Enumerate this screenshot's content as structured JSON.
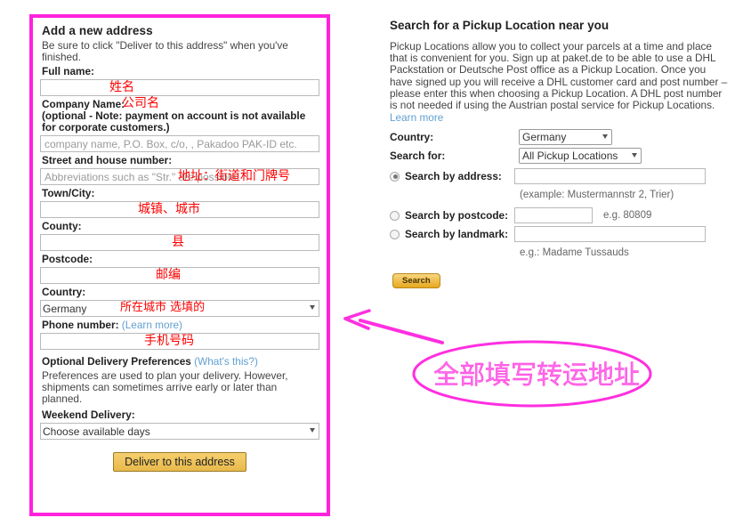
{
  "left_form": {
    "title": "Add a new address",
    "subtitle": "Be sure to click \"Deliver to this address\" when you've finished.",
    "fields": {
      "full_name_label": "Full name:",
      "full_name_value": "",
      "full_name_annotation": "姓名",
      "company_label": "Company Name:",
      "company_annotation": "公司名",
      "company_note": "(optional - Note: payment on account is not available for corporate customers.)",
      "company_placeholder": "company name, P.O. Box, c/o, , Pakadoo PAK-ID etc.",
      "street_label": "Street and house number:",
      "street_placeholder": "Abbreviations such as \"Str.\" are possible.",
      "street_annotation": "地址：街道和门牌号",
      "town_label": "Town/City:",
      "town_annotation": "城镇、城市",
      "county_label": "County:",
      "county_annotation": "县",
      "postcode_label": "Postcode:",
      "postcode_annotation": "邮编",
      "country_label": "Country:",
      "country_value": "Germany",
      "country_annotation": "所在城市 选填的",
      "phone_label": "Phone number:",
      "phone_learn_more": "(Learn more)",
      "phone_annotation": "手机号码",
      "prefs_label": "Optional Delivery Preferences",
      "prefs_whats_this": "(What's this?)",
      "prefs_text": "Preferences are used to plan your delivery. However, shipments can sometimes arrive early or later than planned.",
      "weekend_label": "Weekend Delivery:",
      "weekend_value": "Choose available days"
    },
    "submit_label": "Deliver to this address"
  },
  "right_panel": {
    "title": "Search for a Pickup Location near you",
    "description": "Pickup Locations allow you to collect your parcels at a time and place that is convenient for you. Sign up at paket.de to be able to use a DHL Packstation or Deutsche Post office as a Pickup Location. Once you have signed up you will receive a DHL customer card and post number – please enter this when choosing a Pickup Location. A DHL post number is not needed if using the Austrian postal service for Pickup Locations.",
    "learn_more": "Learn more",
    "country_label": "Country:",
    "country_value": "Germany",
    "search_for_label": "Search for:",
    "search_for_value": "All Pickup Locations",
    "by_address_label": "Search by address:",
    "by_address_value": "",
    "by_address_example": "(example: Mustermannstr 2, Trier)",
    "by_postcode_label": "Search by postcode:",
    "by_postcode_value": "",
    "by_postcode_example": "e.g. 80809",
    "by_landmark_label": "Search by landmark:",
    "by_landmark_value": "",
    "by_landmark_example": "e.g.: Madame Tussauds",
    "search_button": "Search"
  },
  "annotation": {
    "ellipse_text": "全部填写转运地址",
    "border_color": "#ff22dd",
    "ink_color": "#ff2fe0",
    "red_color": "#ff0000"
  }
}
